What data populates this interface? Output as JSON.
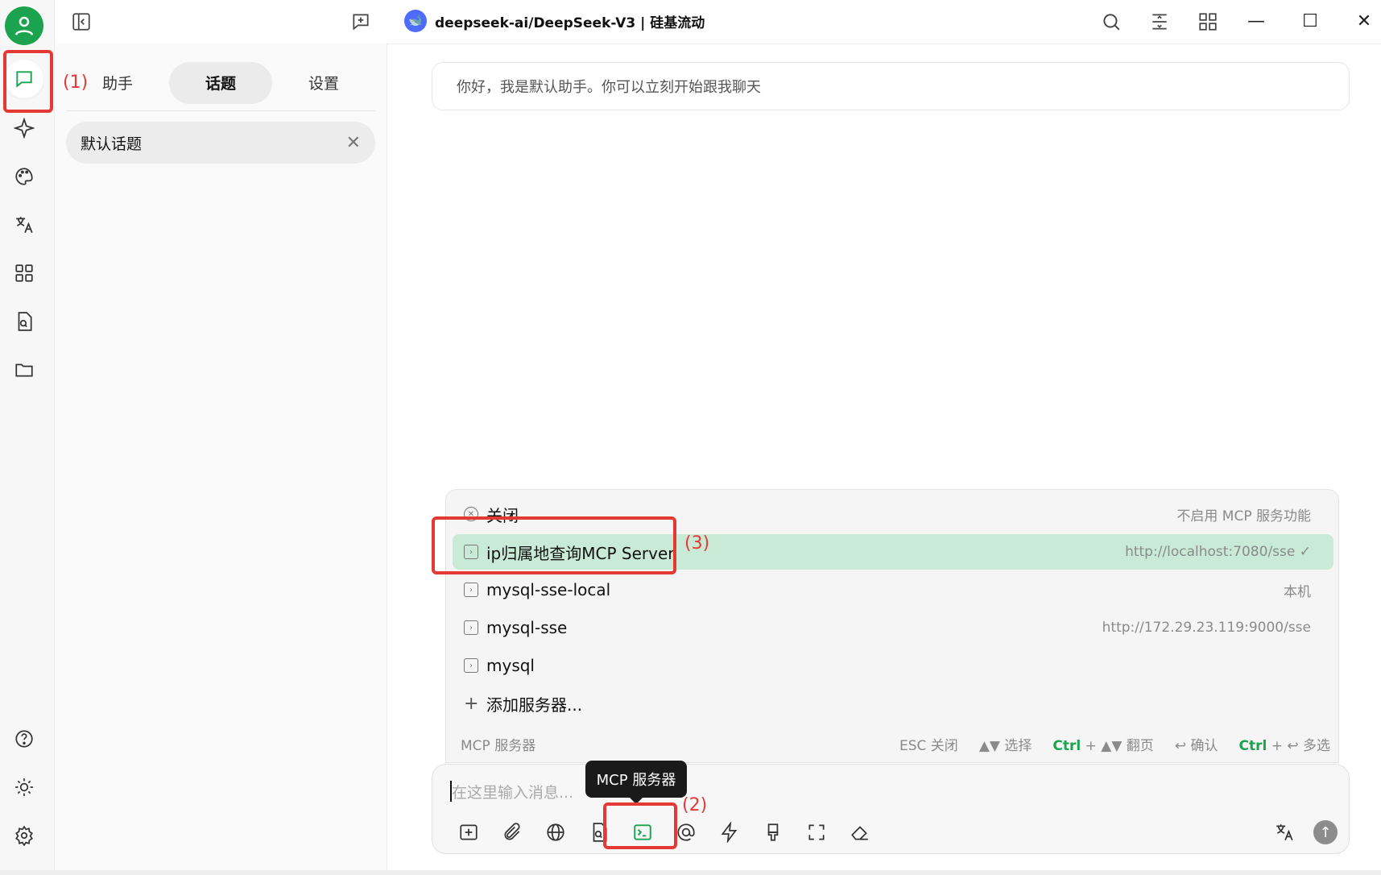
{
  "window": {
    "title": "deepseek-ai/DeepSeek-V3 | 硅基流动",
    "controls": {
      "minimize": "—",
      "maximize": "☐",
      "close": "✕"
    }
  },
  "panel": {
    "tabs": [
      {
        "label": "助手"
      },
      {
        "label": "话题"
      },
      {
        "label": "设置"
      }
    ],
    "topic": {
      "label": "默认话题",
      "close": "✕"
    }
  },
  "chat": {
    "greeting": "你好，我是默认助手。你可以立刻开始跟我聊天"
  },
  "mcp_popup": {
    "items": [
      {
        "label": "关闭",
        "desc": "不启用 MCP 服务功能"
      },
      {
        "label": "ip归属地查询MCP Server",
        "desc": "http://localhost:7080/sse ✓"
      },
      {
        "label": "mysql-sse-local",
        "desc": "本机"
      },
      {
        "label": "mysql-sse",
        "desc": "http://172.29.23.119:9000/sse"
      },
      {
        "label": "mysql",
        "desc": ""
      },
      {
        "label": "添加服务器...",
        "desc": ""
      }
    ],
    "footer": {
      "title": "MCP 服务器",
      "esc": "ESC 关闭",
      "select": "▲▼ 选择",
      "page_key": "Ctrl",
      "page": " + ▲▼ 翻页",
      "confirm": "↩ 确认",
      "multi_key": "Ctrl",
      "multi": " + ↩ 多选"
    }
  },
  "input": {
    "placeholder": "在这里输入消息...",
    "tooltip": "MCP 服务器"
  },
  "annotations": [
    "(1)",
    "(2)",
    "(3)"
  ],
  "colors": {
    "accent": "#1ba34f",
    "selected_row": "#c8ead6",
    "annotation": "#e53935"
  }
}
